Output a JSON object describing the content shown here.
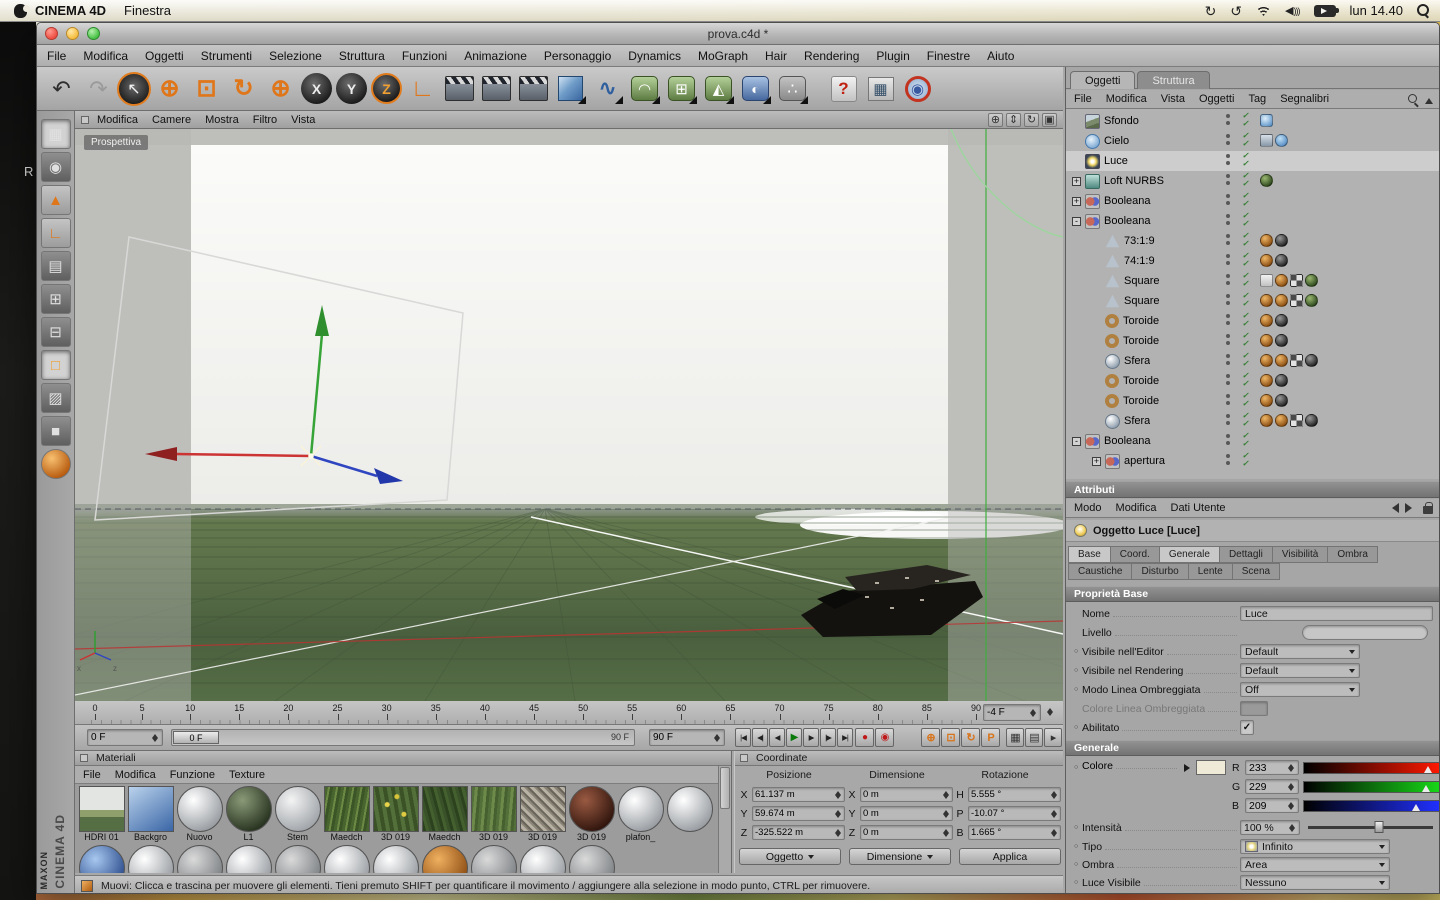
{
  "menubar": {
    "app": "CINEMA 4D",
    "items": [
      "Finestra"
    ],
    "clock": "lun 14.40"
  },
  "desktop": {
    "label": "R"
  },
  "branding": {
    "maxon": "MAXON",
    "cinema": "CINEMA 4D"
  },
  "window": {
    "title": "prova.c4d *"
  },
  "app_menus": [
    "File",
    "Modifica",
    "Oggetti",
    "Strumenti",
    "Selezione",
    "Struttura",
    "Funzioni",
    "Animazione",
    "Personaggio",
    "Dynamics",
    "MoGraph",
    "Hair",
    "Rendering",
    "Plugin",
    "Finestre",
    "Aiuto"
  ],
  "toolbar": {
    "icons": [
      {
        "name": "undo-icon",
        "kind": "undo",
        "glyph": "↶"
      },
      {
        "name": "redo-icon",
        "kind": "redo",
        "glyph": "↷"
      },
      {
        "name": "live-selection-icon",
        "kind": "select",
        "glyph": "↖"
      },
      {
        "name": "move-tool-icon",
        "kind": "move",
        "glyph": "⊕"
      },
      {
        "name": "scale-tool-icon",
        "kind": "scale",
        "glyph": "⊡"
      },
      {
        "name": "rotate-tool-icon",
        "kind": "rotate",
        "glyph": "↻"
      },
      {
        "name": "last-tool-icon",
        "kind": "move",
        "glyph": "⊕"
      },
      {
        "name": "x-axis-lock-icon",
        "kind": "axis",
        "glyph": "X"
      },
      {
        "name": "y-axis-lock-icon",
        "kind": "axis",
        "glyph": "Y"
      },
      {
        "name": "z-axis-lock-icon",
        "kind": "axis-active",
        "glyph": "Z"
      },
      {
        "name": "coordinate-system-icon",
        "kind": "coords",
        "glyph": "∟"
      },
      {
        "name": "render-view-icon",
        "kind": "clapper",
        "glyph": ""
      },
      {
        "name": "render-picture-viewer-icon",
        "kind": "clapper",
        "glyph": ""
      },
      {
        "name": "render-settings-icon",
        "kind": "clapper",
        "glyph": ""
      },
      {
        "name": "primitive-cube-icon",
        "kind": "cube",
        "glyph": "",
        "popup": "1"
      },
      {
        "name": "spline-tools-icon",
        "kind": "spline",
        "glyph": "∿",
        "popup": "1"
      },
      {
        "name": "nurbs-tools-icon",
        "kind": "nurbs",
        "glyph": "◠",
        "popup": "1"
      },
      {
        "name": "modeling-objects-icon",
        "kind": "green",
        "glyph": "⊞",
        "popup": "1"
      },
      {
        "name": "deformer-objects-icon",
        "kind": "green",
        "glyph": "◭",
        "popup": "1"
      },
      {
        "name": "scene-objects-icon",
        "kind": "scene",
        "glyph": "◐",
        "popup": "1"
      },
      {
        "name": "particle-objects-icon",
        "kind": "dots",
        "glyph": "∴",
        "popup": "1"
      },
      {
        "name": "help-icon",
        "kind": "help",
        "glyph": "?"
      },
      {
        "name": "content-browser-icon",
        "kind": "browser",
        "glyph": "▦"
      },
      {
        "name": "online-updater-icon",
        "kind": "globe",
        "glyph": "◉"
      }
    ]
  },
  "left_palette": [
    {
      "name": "use-model-mode-icon",
      "kind": "dark",
      "glyph": "▦",
      "active": 1
    },
    {
      "name": "use-texture-mode-icon",
      "kind": "dark",
      "glyph": "◉"
    },
    {
      "name": "make-editable-icon",
      "kind": "orange",
      "glyph": "▲"
    },
    {
      "name": "use-object-axis-icon",
      "kind": "orange",
      "glyph": "∟"
    },
    {
      "name": "use-animation-mode-icon",
      "kind": "dark",
      "glyph": "▤"
    },
    {
      "name": "use-model-tool-icon",
      "kind": "dark",
      "glyph": "⊞"
    },
    {
      "name": "use-texture-axis-icon",
      "kind": "dark",
      "glyph": "⊟"
    },
    {
      "name": "use-point-mode-icon",
      "kind": "points",
      "glyph": "□",
      "active": 1
    },
    {
      "name": "use-edge-mode-icon",
      "kind": "dark",
      "glyph": "▨"
    },
    {
      "name": "use-polygon-mode-icon",
      "kind": "dark",
      "glyph": "■"
    },
    {
      "name": "use-texture-color-icon",
      "kind": "orangeball",
      "glyph": "●"
    }
  ],
  "viewport": {
    "label": "Prospettiva",
    "menus": [
      "Modifica",
      "Camere",
      "Mostra",
      "Filtro",
      "Vista"
    ],
    "axis_x": "x",
    "axis_z": "z",
    "nav_icons": [
      {
        "name": "pan-camera-icon",
        "glyph": "⊕"
      },
      {
        "name": "dolly-camera-icon",
        "glyph": "⇕"
      },
      {
        "name": "rotate-camera-icon",
        "glyph": "↻"
      },
      {
        "name": "toggle-views-icon",
        "glyph": "▣"
      }
    ]
  },
  "timeline": {
    "ticks": [
      "0",
      "5",
      "10",
      "15",
      "20",
      "25",
      "30",
      "35",
      "40",
      "45",
      "50",
      "55",
      "60",
      "65",
      "70",
      "75",
      "80",
      "85",
      "90"
    ],
    "end_offset": "-4 F"
  },
  "transport": {
    "current_frame": "0 F",
    "slider_start": "0 F",
    "slider_end": "90 F",
    "end_frame": "90 F",
    "playback": [
      {
        "name": "goto-start-button",
        "glyph": "|◀",
        "kind": "nav"
      },
      {
        "name": "prev-key-button",
        "glyph": "◀|",
        "kind": "nav"
      },
      {
        "name": "prev-frame-button",
        "glyph": "◀",
        "kind": "nav"
      },
      {
        "name": "play-button",
        "glyph": "▶",
        "kind": "play"
      },
      {
        "name": "next-frame-button",
        "glyph": "▶",
        "kind": "nav"
      },
      {
        "name": "next-key-button",
        "glyph": "|▶",
        "kind": "nav"
      },
      {
        "name": "goto-end-button",
        "glyph": "▶|",
        "kind": "nav"
      }
    ],
    "records": [
      {
        "name": "record-keyframe-button",
        "glyph": "●",
        "kind": "rec"
      },
      {
        "name": "autokey-button",
        "glyph": "◉",
        "kind": "rec"
      }
    ],
    "key_toggles": [
      {
        "name": "record-position-toggle",
        "glyph": "⊕",
        "kind": "key"
      },
      {
        "name": "record-scale-toggle",
        "glyph": "⊡",
        "kind": "key"
      },
      {
        "name": "record-rotation-toggle",
        "glyph": "↻",
        "kind": "key"
      },
      {
        "name": "record-parameter-toggle",
        "glyph": "P",
        "kind": "key"
      }
    ],
    "extras": [
      {
        "name": "timeline-window-button",
        "glyph": "▦",
        "kind": "ext"
      },
      {
        "name": "fcurve-window-button",
        "glyph": "▤",
        "kind": "ext"
      },
      {
        "name": "powerslider-options-button",
        "glyph": "▸",
        "kind": "ext"
      }
    ]
  },
  "materials": {
    "title": "Materiali",
    "menus": [
      "File",
      "Modifica",
      "Funzione",
      "Texture"
    ],
    "row1": [
      {
        "name": "HDRI 01",
        "style": "hdri"
      },
      {
        "name": "Backgro",
        "style": "blueflat"
      },
      {
        "name": "Nuovo",
        "style": "white"
      },
      {
        "name": "L1",
        "style": "darkgreen"
      },
      {
        "name": "Stem",
        "style": "lightgray"
      },
      {
        "name": "Maedch",
        "style": "grass"
      },
      {
        "name": "3D 019",
        "style": "plants"
      },
      {
        "name": "Maedch",
        "style": "plantsdark"
      },
      {
        "name": "3D 019",
        "style": "grass2"
      },
      {
        "name": "3D 019",
        "style": "twigs"
      },
      {
        "name": "3D 019",
        "style": "darkred"
      },
      {
        "name": "plafon_",
        "style": "white"
      }
    ],
    "row2": [
      {
        "style": "white"
      },
      {
        "style": "blue"
      },
      {
        "style": "white"
      },
      {
        "style": "gray"
      },
      {
        "style": "white"
      },
      {
        "style": "gray"
      },
      {
        "style": "white"
      },
      {
        "style": "white"
      },
      {
        "style": "orange"
      },
      {
        "style": "gray"
      },
      {
        "style": "white"
      },
      {
        "style": "gray"
      }
    ]
  },
  "coordinates": {
    "title": "Coordinate",
    "headers": [
      "Posizione",
      "Dimensione",
      "Rotazione"
    ],
    "pos_rows": [
      {
        "axis": "X",
        "value": "61.137 m"
      },
      {
        "axis": "Y",
        "value": "59.674 m"
      },
      {
        "axis": "Z",
        "value": "-325.522 m"
      }
    ],
    "size_rows": [
      {
        "axis": "X",
        "value": "0 m"
      },
      {
        "axis": "Y",
        "value": "0 m"
      },
      {
        "axis": "Z",
        "value": "0 m"
      }
    ],
    "rot_rows": [
      {
        "axis": "H",
        "value": "5.555 °"
      },
      {
        "axis": "P",
        "value": "-10.07 °"
      },
      {
        "axis": "B",
        "value": "1.665 °"
      }
    ],
    "mode_object": "Oggetto",
    "mode_size": "Dimensione",
    "apply_label": "Applica"
  },
  "status": {
    "text": "Muovi: Clicca e trascina per muovere gli elementi. Tieni premuto SHIFT per quantificare il movimento / aggiungere alla selezione in modo punto, CTRL per rimuovere."
  },
  "objects_panel": {
    "tabs": [
      {
        "label": "Oggetti",
        "active": 1
      },
      {
        "label": "Struttura",
        "active": 0
      }
    ],
    "menus": [
      "File",
      "Modifica",
      "Vista",
      "Oggetti",
      "Tag",
      "Segnalibri"
    ],
    "tree": [
      {
        "label": "Sfondo",
        "icon": "background",
        "indent": 0,
        "expand": "",
        "tags": [
          "sky"
        ]
      },
      {
        "label": "Cielo",
        "icon": "sky",
        "indent": 0,
        "expand": "",
        "tags": [
          "compositing",
          "skymat"
        ]
      },
      {
        "label": "Luce",
        "icon": "light",
        "indent": 0,
        "expand": "",
        "selected": true,
        "tags": []
      },
      {
        "label": "Loft NURBS",
        "icon": "loft",
        "indent": 0,
        "expand": "+",
        "tags": [
          "matgreen"
        ]
      },
      {
        "label": "Booleana",
        "icon": "boole",
        "indent": 0,
        "expand": "+",
        "tags": []
      },
      {
        "label": "Booleana",
        "icon": "boole",
        "indent": 0,
        "expand": "-",
        "tags": []
      },
      {
        "label": "73:1:9",
        "icon": "poly",
        "indent": 1,
        "expand": "",
        "tags": [
          "matorange",
          "matdark"
        ]
      },
      {
        "label": "74:1:9",
        "icon": "poly",
        "indent": 1,
        "expand": "",
        "tags": [
          "matorange",
          "matdark"
        ]
      },
      {
        "label": "Square",
        "icon": "poly",
        "indent": 1,
        "expand": "",
        "tags": [
          "file",
          "matorange",
          "checker",
          "matgreen"
        ]
      },
      {
        "label": "Square",
        "icon": "poly",
        "indent": 1,
        "expand": "",
        "tags": [
          "matorange",
          "matorange",
          "checker",
          "matgreen"
        ]
      },
      {
        "label": "Toroide",
        "icon": "torus",
        "indent": 1,
        "expand": "",
        "tags": [
          "matorange",
          "matdark"
        ]
      },
      {
        "label": "Toroide",
        "icon": "torus",
        "indent": 1,
        "expand": "",
        "tags": [
          "matorange",
          "matdark"
        ]
      },
      {
        "label": "Sfera",
        "icon": "sphere",
        "indent": 1,
        "expand": "",
        "tags": [
          "matorange",
          "matorange",
          "checker",
          "matdark"
        ]
      },
      {
        "label": "Toroide",
        "icon": "torus",
        "indent": 1,
        "expand": "",
        "tags": [
          "matorange",
          "matdark"
        ]
      },
      {
        "label": "Toroide",
        "icon": "torus",
        "indent": 1,
        "expand": "",
        "tags": [
          "matorange",
          "matdark"
        ]
      },
      {
        "label": "Sfera",
        "icon": "sphere",
        "indent": 1,
        "expand": "",
        "tags": [
          "matorange",
          "matorange",
          "checker",
          "matdark"
        ]
      },
      {
        "label": "Booleana",
        "icon": "boole",
        "indent": 0,
        "expand": "-",
        "tags": []
      },
      {
        "label": "apertura",
        "icon": "boole",
        "indent": 1,
        "expand": "+",
        "tags": []
      }
    ]
  },
  "attributes": {
    "title": "Attributi",
    "menus": [
      "Modo",
      "Modifica",
      "Dati Utente"
    ],
    "object_title": "Oggetto Luce [Luce]",
    "tabs_row1": [
      {
        "label": "Base",
        "active": 1
      },
      {
        "label": "Coord.",
        "active": 0
      },
      {
        "label": "Generale",
        "active": 1
      },
      {
        "label": "Dettagli",
        "active": 0
      },
      {
        "label": "Visibilità",
        "active": 0
      },
      {
        "label": "Ombra",
        "active": 0
      }
    ],
    "tabs_row2": [
      {
        "label": "Caustiche",
        "active": 0
      },
      {
        "label": "Disturbo",
        "active": 0
      },
      {
        "label": "Lente",
        "active": 0
      },
      {
        "label": "Scena",
        "active": 0
      }
    ],
    "base_section": "Proprietà Base",
    "base_fields": [
      {
        "label": "Nome",
        "control": "input",
        "value": "Luce"
      },
      {
        "label": "Livello",
        "control": "layer",
        "value": ""
      },
      {
        "label": "Visibile nell'Editor",
        "control": "dropdown",
        "value": "Default",
        "anim": 1
      },
      {
        "label": "Visibile nel Rendering",
        "control": "dropdown",
        "value": "Default",
        "anim": 1
      },
      {
        "label": "Modo Linea Ombreggiata",
        "control": "dropdown",
        "value": "Off",
        "anim": 1
      },
      {
        "label": "Colore Linea Ombreggiata",
        "control": "swatch",
        "value": "",
        "disabled": 1
      },
      {
        "label": "Abilitato",
        "control": "check",
        "value": "",
        "anim": 1
      }
    ],
    "general_section": "Generale",
    "color_label": "Colore",
    "swatch_color": "#efe9d8",
    "color_rows": [
      {
        "ch": "R",
        "value": "233",
        "grad": "red",
        "marker_css": "left:91%"
      },
      {
        "ch": "G",
        "value": "229",
        "grad": "green",
        "marker_css": "left:90%"
      },
      {
        "ch": "B",
        "value": "209",
        "grad": "blue",
        "marker_css": "left:82%"
      }
    ],
    "intensity_label": "Intensità",
    "intensity_value": "100 %",
    "intensity_handle_css": "left:57%",
    "type_label": "Tipo",
    "type_value": "Infinito",
    "shadow_label": "Ombra",
    "shadow_value": "Area",
    "visible_light_label": "Luce Visibile",
    "visible_light_value": "Nessuno"
  }
}
